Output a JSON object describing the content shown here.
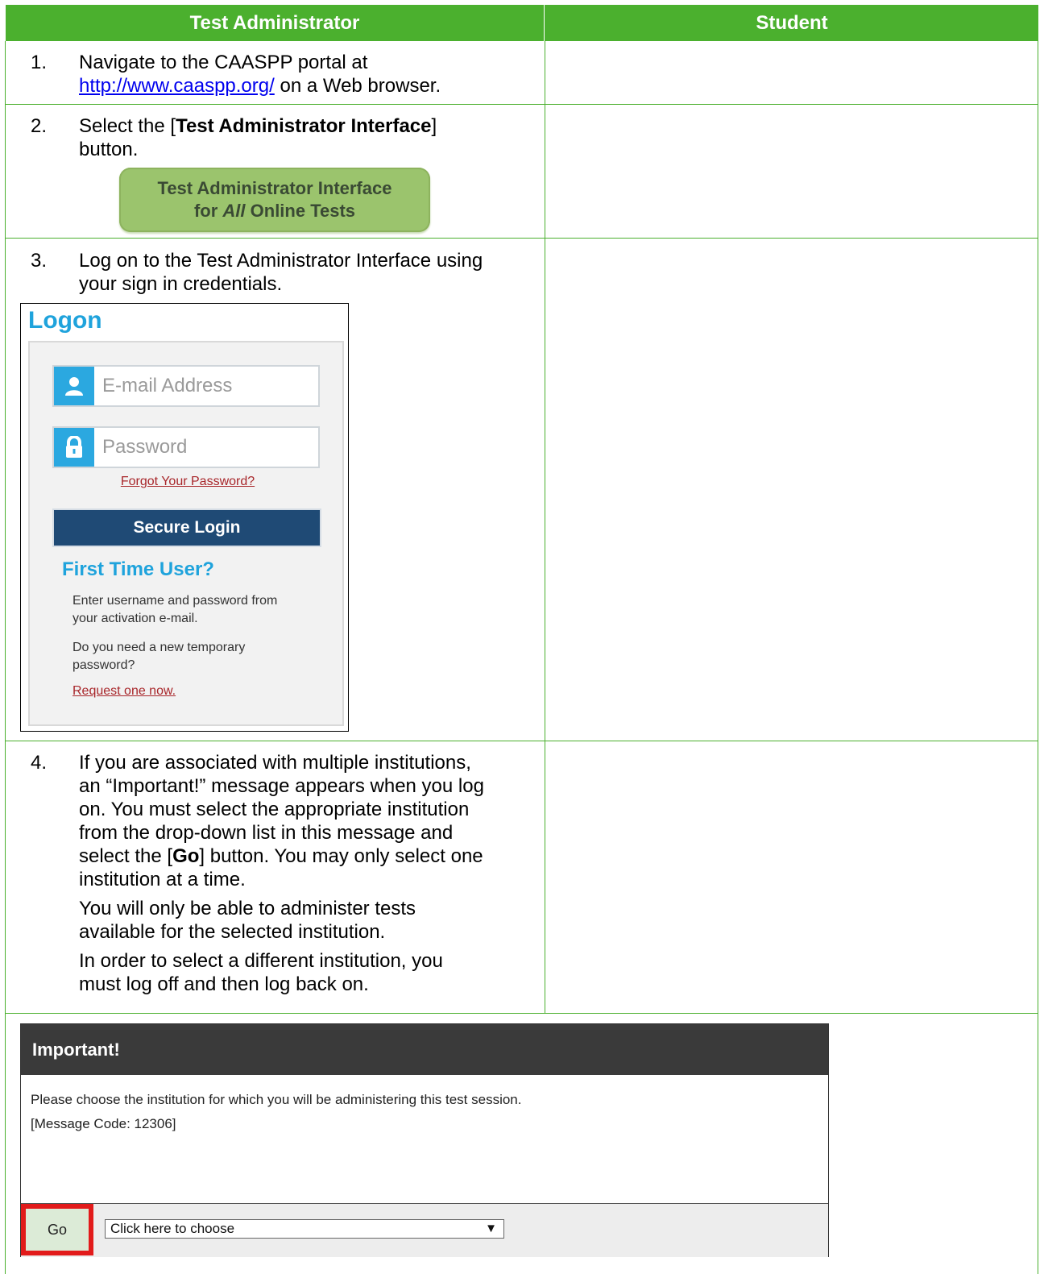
{
  "table": {
    "col_left": "Test Administrator",
    "col_right": "Student"
  },
  "steps": [
    {
      "num": "1.",
      "line1": "Navigate to the CAASPP portal at",
      "link": "http://www.caaspp.org/",
      "after_link": " on a Web browser."
    },
    {
      "num": "2.",
      "pre": "Select the [",
      "bold": "Test Administrator Interface",
      "post": "]",
      "line2": "button."
    },
    {
      "num": "3.",
      "line1": "Log on to the Test Administrator Interface using",
      "line2": "your sign in credentials."
    },
    {
      "num": "4.",
      "p1": [
        "If you are associated with multiple institutions,",
        "an “Important!” message appears when you log",
        "on. You must select the appropriate institution",
        "from the drop-down list in this message and"
      ],
      "p1_last_pre": "select the [",
      "p1_last_bold": "Go",
      "p1_last_post": "] button. You may only select one",
      "p1_end": "institution at a time.",
      "p2": [
        "You will only be able to administer tests",
        "available for the selected institution."
      ],
      "p3": [
        "In order to select a different institution, you",
        "must log off and then log back on."
      ]
    }
  ],
  "tai_button": {
    "line1": "Test Administrator Interface",
    "line2_pre": "for ",
    "line2_italic": "All",
    "line2_post": " Online Tests"
  },
  "logon": {
    "title": "Logon",
    "email_placeholder": "E-mail Address",
    "password_placeholder": "Password",
    "forgot": "Forgot Your Password?",
    "secure_login": "Secure Login",
    "first_time": "First Time User?",
    "info1": [
      "Enter username and password from",
      "your activation e-mail."
    ],
    "info2": [
      "Do you need a new temporary",
      "password?"
    ],
    "request": "Request one now."
  },
  "important": {
    "title": "Important!",
    "message": "Please choose the institution for which you will be administering this test session.",
    "code": "[Message Code: 12306]",
    "go": "Go",
    "select_value": "Click here to choose"
  },
  "colors": {
    "header_green": "#4bb02e",
    "logon_blue": "#1fa3dc",
    "secure_navy": "#1f4a75",
    "highlight_red": "#e21b1b"
  }
}
